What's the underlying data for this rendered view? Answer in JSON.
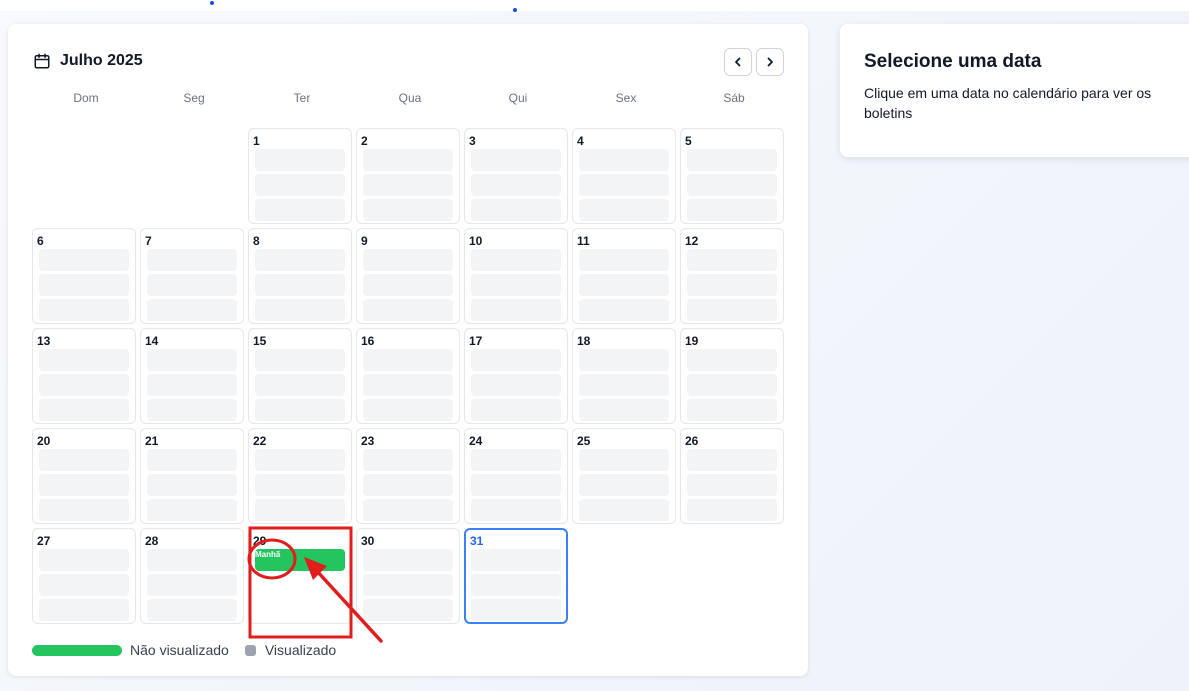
{
  "calendar": {
    "month_title": "Julho 2025",
    "weekdays": [
      "Dom",
      "Seg",
      "Ter",
      "Qua",
      "Qui",
      "Sex",
      "Sáb"
    ],
    "first_weekday_index": 2,
    "days_in_month": 31,
    "today": 31,
    "bulletins": [
      {
        "day": 29,
        "label": "Manhã",
        "status": "não visualizado",
        "color": "#22c55e"
      }
    ]
  },
  "legend": {
    "unviewed_label": "Não visualizado",
    "viewed_label": "Visualizado",
    "unviewed_color": "#22c55e",
    "viewed_color": "#9ca3af"
  },
  "details": {
    "title": "Selecione uma data",
    "instructions": "Clique em uma data no calendário para ver os boletins"
  },
  "colors": {
    "today_border": "#3b82f6",
    "annotation": "#e11d1d"
  }
}
